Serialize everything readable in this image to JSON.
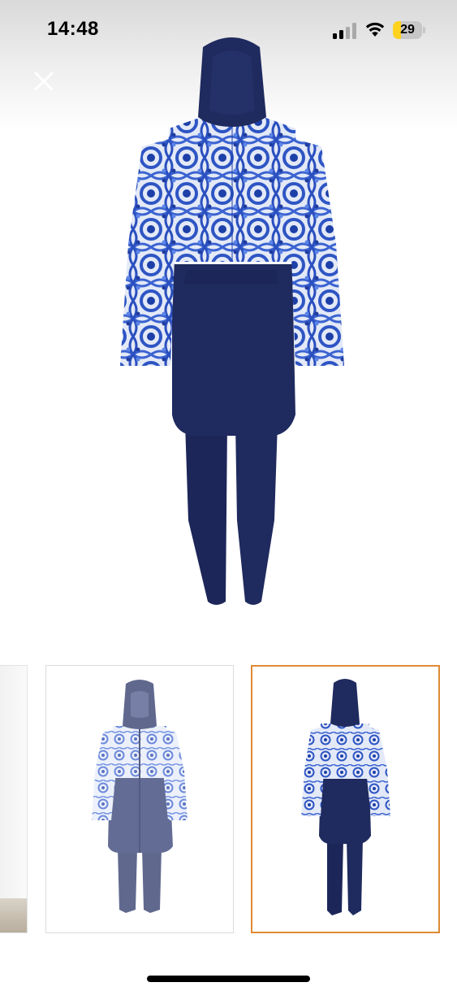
{
  "status_bar": {
    "time": "14:48",
    "battery_level": "29",
    "battery_fraction": 0.29,
    "signal_icon": "cellular-signal-icon",
    "wifi_icon": "wifi-icon"
  },
  "viewer": {
    "close_icon": "close-icon",
    "main_image_alt": "",
    "selected_thumbnail_index": 2
  },
  "thumbnails": [
    {
      "name": "thumbnail-partial",
      "selected": false
    },
    {
      "name": "thumbnail-front-view",
      "selected": false
    },
    {
      "name": "thumbnail-back-view",
      "selected": true
    }
  ],
  "colors": {
    "navy": "#1f2a5e",
    "print_blue": "#2e55c4",
    "print_light": "#dfe6f6",
    "selected_border": "#e08a33"
  }
}
